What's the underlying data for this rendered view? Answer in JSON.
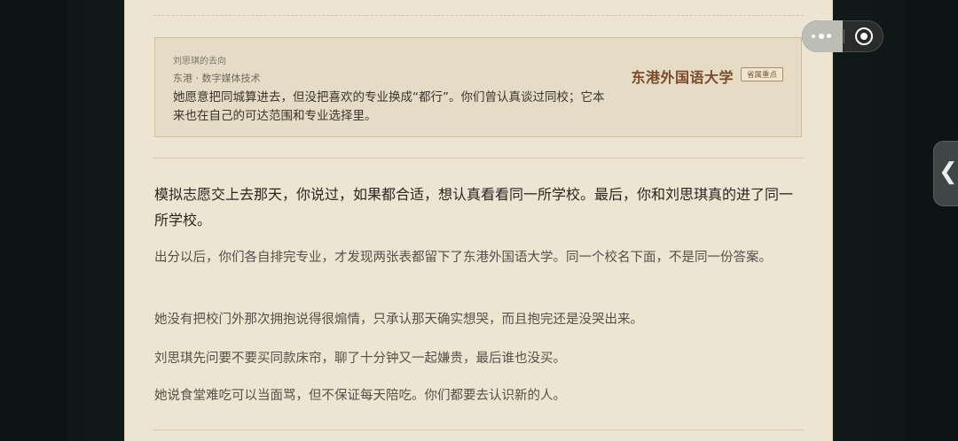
{
  "card": {
    "kicker": "刘思琪的去向",
    "meta": "东港 · 数字媒体技术",
    "body": "她愿意把同城算进去，但没把喜欢的专业换成“都行”。你们曾认真谈过同校；它本来也在自己的可达范围和专业选择里。",
    "school": "东港外国语大学",
    "badge": "省属重点"
  },
  "story": {
    "lead": "模拟志愿交上去那天，你说过，如果都合适，想认真看看同一所学校。最后，你和刘思琪真的进了同一所学校。",
    "paragraphs": [
      "出分以后，你们各自排完专业，才发现两张表都留下了东港外国语大学。同一个校名下面，不是同一份答案。",
      "她没有把校门外那次拥抱说得很煽情，只承认那天确实想哭，而且抱完还是没哭出来。",
      "刘思琪先问要不要买同款床帘，聊了十分钟又一起嫌贵，最后谁也没买。",
      "她说食堂难吃可以当面骂，但不保证每天陪吃。你们都要去认识新的人。"
    ]
  },
  "icons": {
    "more": "more-dots-icon",
    "close": "target-close-icon",
    "side": "chevron-left-icon"
  }
}
